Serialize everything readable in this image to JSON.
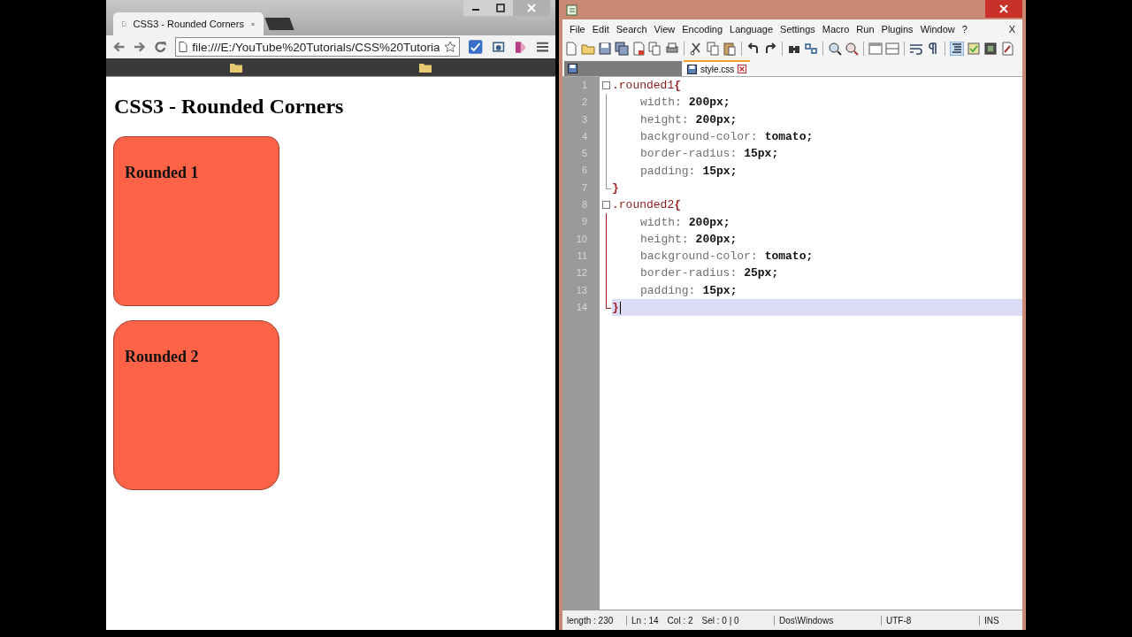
{
  "browser": {
    "tab": {
      "title": "CSS3 - Rounded Corners",
      "selected": true
    },
    "address": "file:///E:/YouTube%20Tutorials/CSS%20Tutoria",
    "page": {
      "heading": "CSS3 - Rounded Corners",
      "boxes": [
        {
          "label": "Rounded 1",
          "kind": "small-radius"
        },
        {
          "label": "Rounded 2",
          "kind": "large-radius"
        }
      ]
    }
  },
  "editor": {
    "menu": [
      "File",
      "Edit",
      "Search",
      "View",
      "Encoding",
      "Language",
      "Settings",
      "Macro",
      "Run",
      "Plugins",
      "Window",
      "?"
    ],
    "close": "X",
    "tabs": [
      {
        "selected": false
      },
      {
        "label": "style.css",
        "selected": true
      }
    ],
    "lines": [
      {
        "number": "1",
        "kind": "open",
        "selector": ".rounded1",
        "brace": "{",
        "current": false
      },
      {
        "number": "2",
        "kind": "decl",
        "property": "width:",
        "value": "200px;",
        "current": false
      },
      {
        "number": "3",
        "kind": "decl",
        "property": "height:",
        "value": "200px;",
        "current": false
      },
      {
        "number": "4",
        "kind": "decl",
        "property": "background-color:",
        "value": "tomato;",
        "current": false
      },
      {
        "number": "5",
        "kind": "decl",
        "property": "border-radius:",
        "value": "15px;",
        "current": false
      },
      {
        "number": "6",
        "kind": "decl",
        "property": "padding:",
        "value": "15px;",
        "current": false
      },
      {
        "number": "7",
        "kind": "close",
        "brace": "}",
        "current": false
      },
      {
        "number": "8",
        "kind": "open",
        "selector": ".rounded2",
        "brace": "{",
        "current": false
      },
      {
        "number": "9",
        "kind": "decl",
        "property": "width:",
        "value": "200px;",
        "current": false
      },
      {
        "number": "10",
        "kind": "decl",
        "property": "height:",
        "value": "200px;",
        "current": false
      },
      {
        "number": "11",
        "kind": "decl",
        "property": "background-color:",
        "value": "tomato;",
        "current": false
      },
      {
        "number": "12",
        "kind": "decl",
        "property": "border-radius:",
        "value": "25px;",
        "current": false
      },
      {
        "number": "13",
        "kind": "decl",
        "property": "padding:",
        "value": "15px;",
        "current": false
      },
      {
        "number": "14",
        "kind": "close",
        "brace": "}",
        "current": true
      }
    ],
    "status_bar": [
      "length : 230",
      "Ln : 14",
      "Col : 2",
      "Sel : 0 | 0",
      "Dos\\Windows",
      "UTF-8",
      "INS"
    ]
  }
}
